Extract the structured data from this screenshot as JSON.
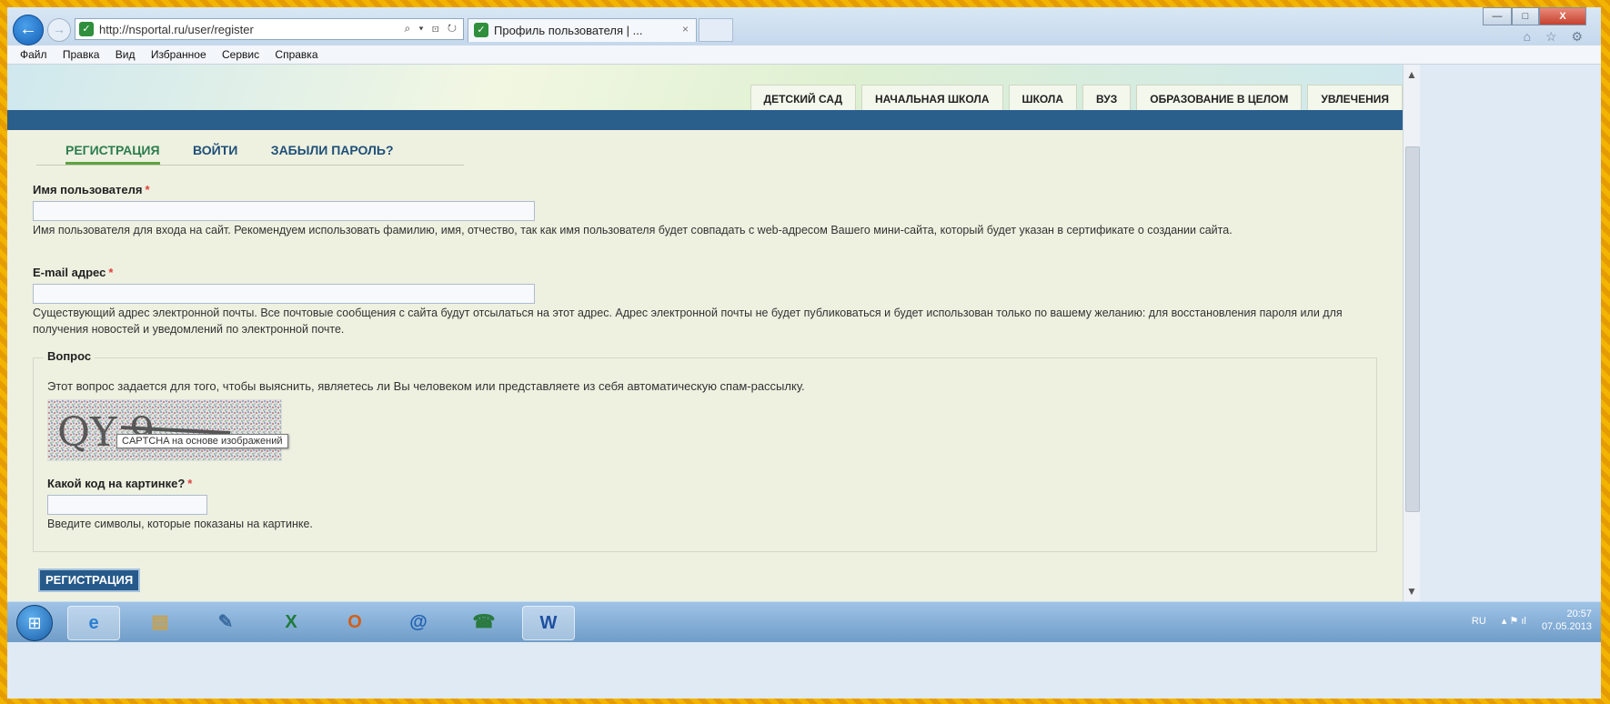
{
  "browser": {
    "url": "http://nsportal.ru/user/register",
    "url_controls": "⌕ ▾ ⊡ ↻",
    "tab_title": "Профиль пользователя | ...",
    "tab_close": "×",
    "win_min": "—",
    "win_max": "□",
    "win_close": "X",
    "tools": "⌂ ☆ ⚙",
    "back": "←",
    "forward": "→"
  },
  "menu": [
    "Файл",
    "Правка",
    "Вид",
    "Избранное",
    "Сервис",
    "Справка"
  ],
  "site_nav": [
    "ДЕТСКИЙ САД",
    "НАЧАЛЬНАЯ ШКОЛА",
    "ШКОЛА",
    "ВУЗ",
    "ОБРАЗОВАНИЕ В ЦЕЛОМ",
    "УВЛЕЧЕНИЯ"
  ],
  "form_tabs": [
    "РЕГИСТРАЦИЯ",
    "ВОЙТИ",
    "ЗАБЫЛИ ПАРОЛЬ?"
  ],
  "username": {
    "label": "Имя пользователя",
    "required": "*",
    "value": "",
    "description": "Имя пользователя для входа на сайт. Рекомендуем использовать фамилию, имя, отчество, так как имя пользователя будет совпадать с web-адресом Вашего мини-сайта, который будет указан в сертификате о создании сайта."
  },
  "email": {
    "label": "E-mail адрес",
    "required": "*",
    "value": "",
    "description": "Существующий адрес электронной почты. Все почтовые сообщения с сайта будут отсылаться на этот адрес. Адрес электронной почты не будет публиковаться и будет использован только по вашему желанию: для восстановления пароля или для получения новостей и уведомлений по электронной почте."
  },
  "question": {
    "legend": "Вопрос",
    "intro": "Этот вопрос задается для того, чтобы выяснить, являетесь ли Вы человеком или представляете из себя автоматическую спам-рассылку.",
    "captcha_text": "QY 9",
    "tooltip": "CAPTCHA на основе изображений",
    "code_label": "Какой код на картинке?",
    "required": "*",
    "code_value": "",
    "code_description": "Введите символы, которые показаны на картинке."
  },
  "submit_label": "РЕГИСТРАЦИЯ",
  "taskbar": {
    "start": "⊞",
    "apps": [
      "e",
      "▤",
      "✎",
      "X",
      "O",
      "@",
      "☎",
      "W"
    ],
    "language": "RU",
    "tray_icons": "▴ ⚑ ıl",
    "time": "20:57",
    "date": "07.05.2013"
  },
  "scrollbar": {
    "up": "▲",
    "down": "▼"
  }
}
